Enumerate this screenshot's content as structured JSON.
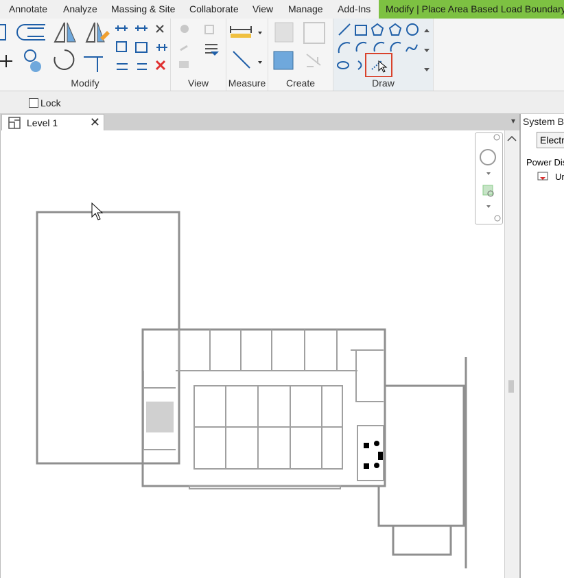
{
  "tabs": [
    "Annotate",
    "Analyze",
    "Massing & Site",
    "Collaborate",
    "View",
    "Manage",
    "Add-Ins",
    "Modify | Place Area Based Load Boundary"
  ],
  "ribbon": {
    "groups": [
      "Modify",
      "View",
      "Measure",
      "Create",
      "Draw"
    ]
  },
  "options_bar": {
    "lock_label": "Lock"
  },
  "view": {
    "tab_label": "Level 1",
    "close": "✕",
    "menu": "▾"
  },
  "system_browser": {
    "title": "System Bro",
    "dropdown": "Electri",
    "tree_root": "Power Dist",
    "tree_child": "Ur"
  },
  "colors": {
    "active_tab": "#7dc142",
    "highlight": "#d9422c",
    "draw_blue": "#1f5fa8"
  }
}
